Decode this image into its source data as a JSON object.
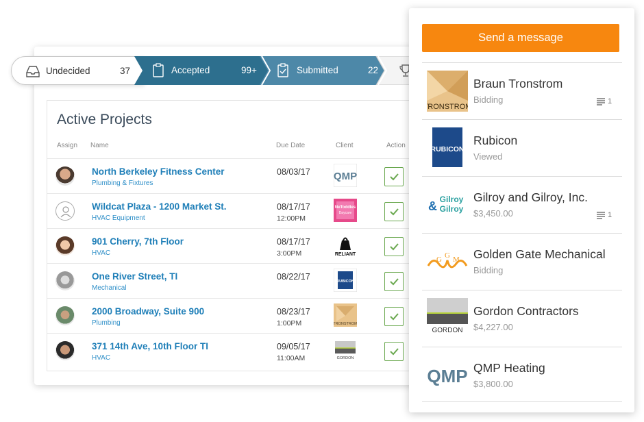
{
  "pipeline": {
    "stages": [
      {
        "label": "Undecided",
        "count": "37"
      },
      {
        "label": "Accepted",
        "count": "99+"
      },
      {
        "label": "Submitted",
        "count": "22"
      }
    ]
  },
  "projects": {
    "title": "Active Projects",
    "headers": {
      "assign": "Assign",
      "name": "Name",
      "due": "Due Date",
      "client": "Client",
      "action": "Action"
    },
    "rows": [
      {
        "name": "North Berkeley Fitness Center",
        "type": "Plumbing & Fixtures",
        "date": "08/03/17",
        "time": "",
        "client_logo": "QMP"
      },
      {
        "name": "Wildcat Plaza - 1200 Market St.",
        "type": "HVAC Equipment",
        "date": "08/17/17",
        "time": "12:00PM",
        "client_logo": "NeToddles"
      },
      {
        "name": "901 Cherry, 7th Floor",
        "type": "HVAC",
        "date": "08/17/17",
        "time": "3:00PM",
        "client_logo": "RELIANT"
      },
      {
        "name": "One River Street, TI",
        "type": "Mechanical",
        "date": "08/22/17",
        "time": "",
        "client_logo": "RUBICON"
      },
      {
        "name": "2000 Broadway, Suite 900",
        "type": "Plumbing",
        "date": "08/23/17",
        "time": "1:00PM",
        "client_logo": "TRONSTROM"
      },
      {
        "name": "371 14th Ave, 10th Floor TI",
        "type": "HVAC",
        "date": "09/05/17",
        "time": "11:00AM",
        "client_logo": "GORDON"
      }
    ]
  },
  "panel": {
    "send_label": "Send a message",
    "bidders": [
      {
        "name": "Braun Tronstrom",
        "status": "Bidding",
        "notes": "1",
        "logo_text": "TRONSTROM"
      },
      {
        "name": "Rubicon",
        "status": "Viewed",
        "notes": "",
        "logo_text": "RUBICON"
      },
      {
        "name": "Gilroy and Gilroy, Inc.",
        "status": "$3,450.00",
        "notes": "1",
        "logo_text": "Gilroy & Gilroy"
      },
      {
        "name": "Golden Gate Mechanical",
        "status": "Bidding",
        "notes": "",
        "logo_text": "GGM"
      },
      {
        "name": "Gordon Contractors",
        "status": "$4,227.00",
        "notes": "",
        "logo_text": "GORDON"
      },
      {
        "name": "QMP Heating",
        "status": "$3,800.00",
        "notes": "",
        "logo_text": "QMP"
      }
    ]
  },
  "colors": {
    "accent_orange": "#f7870f",
    "stage_blue": "#2d6f8e",
    "link_blue": "#1f7fb8",
    "check_green": "#6aa84f"
  }
}
